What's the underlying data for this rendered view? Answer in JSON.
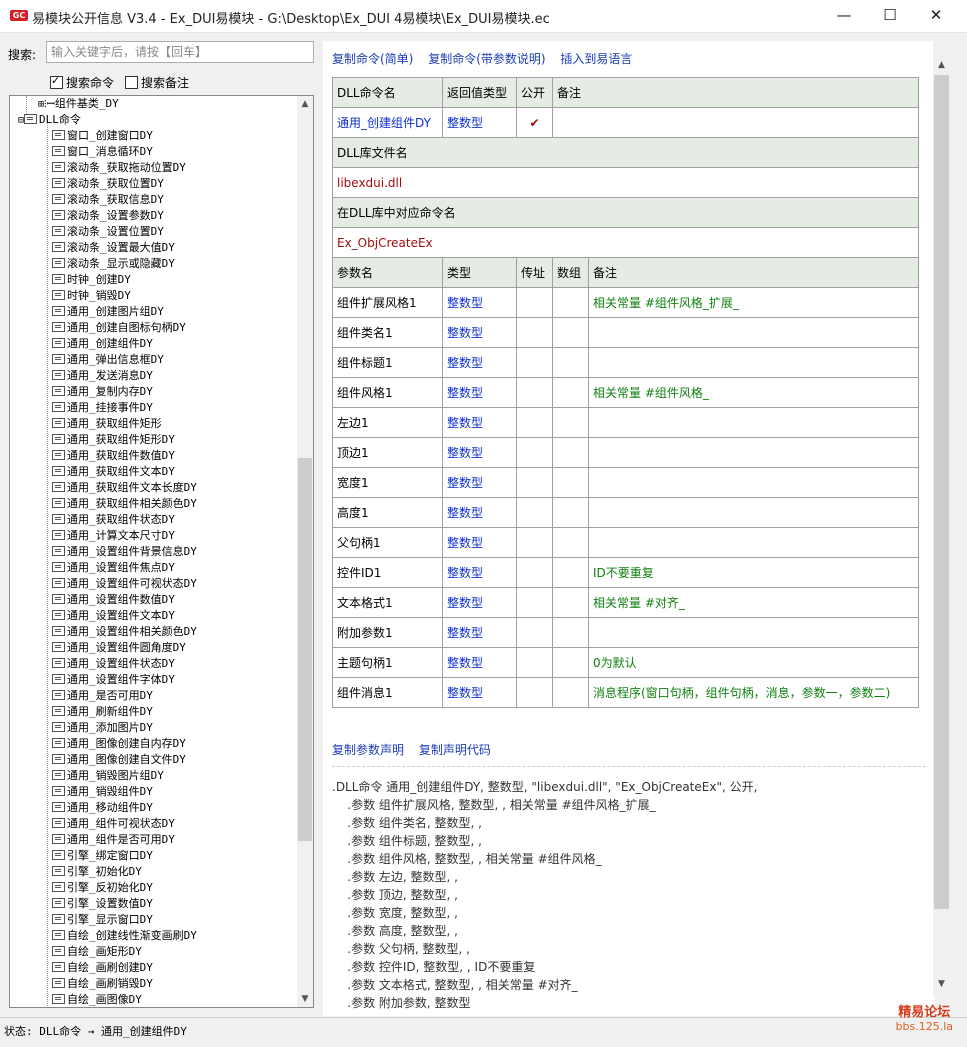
{
  "window": {
    "title": "易模块公开信息 V3.4 - Ex_DUI易模块 - G:\\Desktop\\Ex_DUI 4易模块\\Ex_DUI易模块.ec",
    "app_icon_text": "GC",
    "minimize": "—",
    "maximize": "☐",
    "close": "✕"
  },
  "search": {
    "label": "搜索:",
    "placeholder": "输入关键字后，请按【回车】",
    "value": "",
    "opt_commands": "搜索命令",
    "opt_commands_checked": true,
    "opt_notes": "搜索备注",
    "opt_notes_checked": false
  },
  "tree": {
    "group1": "组件基类_DY",
    "group2": "DLL命令",
    "items": [
      "窗口_创建窗口DY",
      "窗口_消息循环DY",
      "滚动条_获取拖动位置DY",
      "滚动条_获取位置DY",
      "滚动条_获取信息DY",
      "滚动条_设置参数DY",
      "滚动条_设置位置DY",
      "滚动条_设置最大值DY",
      "滚动条_显示或隐藏DY",
      "时钟_创建DY",
      "时钟_销毁DY",
      "通用_创建图片组DY",
      "通用_创建自图标句柄DY",
      "通用_创建组件DY",
      "通用_弹出信息框DY",
      "通用_发送消息DY",
      "通用_复制内存DY",
      "通用_挂接事件DY",
      "通用_获取组件矩形",
      "通用_获取组件矩形DY",
      "通用_获取组件数值DY",
      "通用_获取组件文本DY",
      "通用_获取组件文本长度DY",
      "通用_获取组件相关颜色DY",
      "通用_获取组件状态DY",
      "通用_计算文本尺寸DY",
      "通用_设置组件背景信息DY",
      "通用_设置组件焦点DY",
      "通用_设置组件可视状态DY",
      "通用_设置组件数值DY",
      "通用_设置组件文本DY",
      "通用_设置组件相关颜色DY",
      "通用_设置组件圆角度DY",
      "通用_设置组件状态DY",
      "通用_设置组件字体DY",
      "通用_是否可用DY",
      "通用_刷新组件DY",
      "通用_添加图片DY",
      "通用_图像创建自内存DY",
      "通用_图像创建自文件DY",
      "通用_销毁图片组DY",
      "通用_销毁组件DY",
      "通用_移动组件DY",
      "通用_组件可视状态DY",
      "通用_组件是否可用DY",
      "引擎_绑定窗口DY",
      "引擎_初始化DY",
      "引擎_反初始化DY",
      "引擎_设置数值DY",
      "引擎_显示窗口DY",
      "自绘_创建线性渐变画刷DY",
      "自绘_画矩形DY",
      "自绘_画刷创建DY",
      "自绘_画刷销毁DY",
      "自绘_画图像DY"
    ]
  },
  "actions": {
    "copy_simple": "复制命令(简单)",
    "copy_full": "复制命令(带参数说明)",
    "insert": "插入到易语言"
  },
  "dll": {
    "h_name": "DLL命令名",
    "h_ret": "返回值类型",
    "h_public": "公开",
    "h_note": "备注",
    "name": "通用_创建组件DY",
    "ret": "整数型",
    "public_mark": "✔",
    "note": "",
    "lib_label": "DLL库文件名",
    "lib": "libexdui.dll",
    "entry_label": "在DLL库中对应命令名",
    "entry": "Ex_ObjCreateEx",
    "p_name": "参数名",
    "p_type": "类型",
    "p_byref": "传址",
    "p_array": "数组",
    "p_note": "备注",
    "params": [
      {
        "name": "组件扩展风格1",
        "type": "整数型",
        "note": "相关常量 #组件风格_扩展_"
      },
      {
        "name": "组件类名1",
        "type": "整数型",
        "note": ""
      },
      {
        "name": "组件标题1",
        "type": "整数型",
        "note": ""
      },
      {
        "name": "组件风格1",
        "type": "整数型",
        "note": "相关常量 #组件风格_"
      },
      {
        "name": "左边1",
        "type": "整数型",
        "note": ""
      },
      {
        "name": "顶边1",
        "type": "整数型",
        "note": ""
      },
      {
        "name": "宽度1",
        "type": "整数型",
        "note": ""
      },
      {
        "name": "高度1",
        "type": "整数型",
        "note": ""
      },
      {
        "name": "父句柄1",
        "type": "整数型",
        "note": ""
      },
      {
        "name": "控件ID1",
        "type": "整数型",
        "note": "ID不要重复"
      },
      {
        "name": "文本格式1",
        "type": "整数型",
        "note": "相关常量 #对齐_"
      },
      {
        "name": "附加参数1",
        "type": "整数型",
        "note": ""
      },
      {
        "name": "主题句柄1",
        "type": "整数型",
        "note": "0为默认"
      },
      {
        "name": "组件消息1",
        "type": "整数型",
        "note": "消息程序(窗口句柄，组件句柄，消息，参数一，参数二)"
      }
    ]
  },
  "code_actions": {
    "copy_params": "复制参数声明",
    "copy_code": "复制声明代码"
  },
  "code_lines": [
    ".DLL命令 通用_创建组件DY, 整数型, \"libexdui.dll\", \"Ex_ObjCreateEx\", 公开,",
    "    .参数 组件扩展风格, 整数型, , 相关常量 #组件风格_扩展_",
    "    .参数 组件类名, 整数型, ,",
    "    .参数 组件标题, 整数型, ,",
    "    .参数 组件风格, 整数型, , 相关常量 #组件风格_",
    "    .参数 左边, 整数型, ,",
    "    .参数 顶边, 整数型, ,",
    "    .参数 宽度, 整数型, ,",
    "    .参数 高度, 整数型, ,",
    "    .参数 父句柄, 整数型, ,",
    "    .参数 控件ID, 整数型, , ID不要重复",
    "    .参数 文本格式, 整数型, , 相关常量 #对齐_",
    "    .参数 附加参数, 整数型"
  ],
  "status": {
    "text": "状态: DLL命令 → 通用_创建组件DY"
  },
  "watermark": {
    "line1": "精易论坛",
    "line2": "bbs.125.la"
  },
  "colors": {
    "link": "#1b3bb5",
    "type_blue": "#1030d0",
    "dll_red": "#a40c0c",
    "note_green": "#118011",
    "header_bg": "#e4ece4"
  }
}
